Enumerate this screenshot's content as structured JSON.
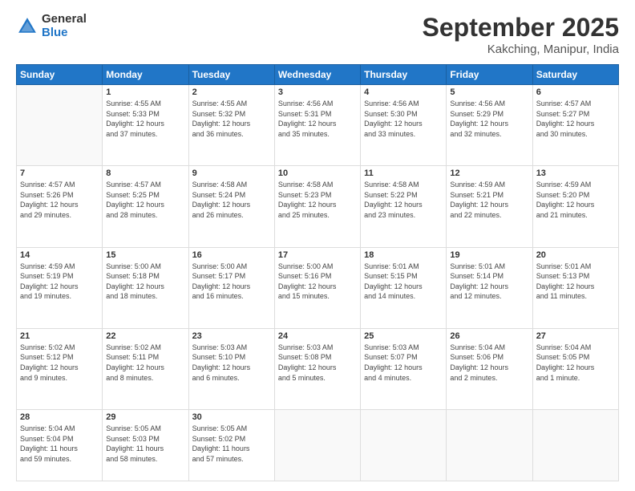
{
  "logo": {
    "general": "General",
    "blue": "Blue"
  },
  "header": {
    "title": "September 2025",
    "location": "Kakching, Manipur, India"
  },
  "weekdays": [
    "Sunday",
    "Monday",
    "Tuesday",
    "Wednesday",
    "Thursday",
    "Friday",
    "Saturday"
  ],
  "weeks": [
    [
      {
        "day": "",
        "info": ""
      },
      {
        "day": "1",
        "info": "Sunrise: 4:55 AM\nSunset: 5:33 PM\nDaylight: 12 hours\nand 37 minutes."
      },
      {
        "day": "2",
        "info": "Sunrise: 4:55 AM\nSunset: 5:32 PM\nDaylight: 12 hours\nand 36 minutes."
      },
      {
        "day": "3",
        "info": "Sunrise: 4:56 AM\nSunset: 5:31 PM\nDaylight: 12 hours\nand 35 minutes."
      },
      {
        "day": "4",
        "info": "Sunrise: 4:56 AM\nSunset: 5:30 PM\nDaylight: 12 hours\nand 33 minutes."
      },
      {
        "day": "5",
        "info": "Sunrise: 4:56 AM\nSunset: 5:29 PM\nDaylight: 12 hours\nand 32 minutes."
      },
      {
        "day": "6",
        "info": "Sunrise: 4:57 AM\nSunset: 5:27 PM\nDaylight: 12 hours\nand 30 minutes."
      }
    ],
    [
      {
        "day": "7",
        "info": "Sunrise: 4:57 AM\nSunset: 5:26 PM\nDaylight: 12 hours\nand 29 minutes."
      },
      {
        "day": "8",
        "info": "Sunrise: 4:57 AM\nSunset: 5:25 PM\nDaylight: 12 hours\nand 28 minutes."
      },
      {
        "day": "9",
        "info": "Sunrise: 4:58 AM\nSunset: 5:24 PM\nDaylight: 12 hours\nand 26 minutes."
      },
      {
        "day": "10",
        "info": "Sunrise: 4:58 AM\nSunset: 5:23 PM\nDaylight: 12 hours\nand 25 minutes."
      },
      {
        "day": "11",
        "info": "Sunrise: 4:58 AM\nSunset: 5:22 PM\nDaylight: 12 hours\nand 23 minutes."
      },
      {
        "day": "12",
        "info": "Sunrise: 4:59 AM\nSunset: 5:21 PM\nDaylight: 12 hours\nand 22 minutes."
      },
      {
        "day": "13",
        "info": "Sunrise: 4:59 AM\nSunset: 5:20 PM\nDaylight: 12 hours\nand 21 minutes."
      }
    ],
    [
      {
        "day": "14",
        "info": "Sunrise: 4:59 AM\nSunset: 5:19 PM\nDaylight: 12 hours\nand 19 minutes."
      },
      {
        "day": "15",
        "info": "Sunrise: 5:00 AM\nSunset: 5:18 PM\nDaylight: 12 hours\nand 18 minutes."
      },
      {
        "day": "16",
        "info": "Sunrise: 5:00 AM\nSunset: 5:17 PM\nDaylight: 12 hours\nand 16 minutes."
      },
      {
        "day": "17",
        "info": "Sunrise: 5:00 AM\nSunset: 5:16 PM\nDaylight: 12 hours\nand 15 minutes."
      },
      {
        "day": "18",
        "info": "Sunrise: 5:01 AM\nSunset: 5:15 PM\nDaylight: 12 hours\nand 14 minutes."
      },
      {
        "day": "19",
        "info": "Sunrise: 5:01 AM\nSunset: 5:14 PM\nDaylight: 12 hours\nand 12 minutes."
      },
      {
        "day": "20",
        "info": "Sunrise: 5:01 AM\nSunset: 5:13 PM\nDaylight: 12 hours\nand 11 minutes."
      }
    ],
    [
      {
        "day": "21",
        "info": "Sunrise: 5:02 AM\nSunset: 5:12 PM\nDaylight: 12 hours\nand 9 minutes."
      },
      {
        "day": "22",
        "info": "Sunrise: 5:02 AM\nSunset: 5:11 PM\nDaylight: 12 hours\nand 8 minutes."
      },
      {
        "day": "23",
        "info": "Sunrise: 5:03 AM\nSunset: 5:10 PM\nDaylight: 12 hours\nand 6 minutes."
      },
      {
        "day": "24",
        "info": "Sunrise: 5:03 AM\nSunset: 5:08 PM\nDaylight: 12 hours\nand 5 minutes."
      },
      {
        "day": "25",
        "info": "Sunrise: 5:03 AM\nSunset: 5:07 PM\nDaylight: 12 hours\nand 4 minutes."
      },
      {
        "day": "26",
        "info": "Sunrise: 5:04 AM\nSunset: 5:06 PM\nDaylight: 12 hours\nand 2 minutes."
      },
      {
        "day": "27",
        "info": "Sunrise: 5:04 AM\nSunset: 5:05 PM\nDaylight: 12 hours\nand 1 minute."
      }
    ],
    [
      {
        "day": "28",
        "info": "Sunrise: 5:04 AM\nSunset: 5:04 PM\nDaylight: 11 hours\nand 59 minutes."
      },
      {
        "day": "29",
        "info": "Sunrise: 5:05 AM\nSunset: 5:03 PM\nDaylight: 11 hours\nand 58 minutes."
      },
      {
        "day": "30",
        "info": "Sunrise: 5:05 AM\nSunset: 5:02 PM\nDaylight: 11 hours\nand 57 minutes."
      },
      {
        "day": "",
        "info": ""
      },
      {
        "day": "",
        "info": ""
      },
      {
        "day": "",
        "info": ""
      },
      {
        "day": "",
        "info": ""
      }
    ]
  ]
}
